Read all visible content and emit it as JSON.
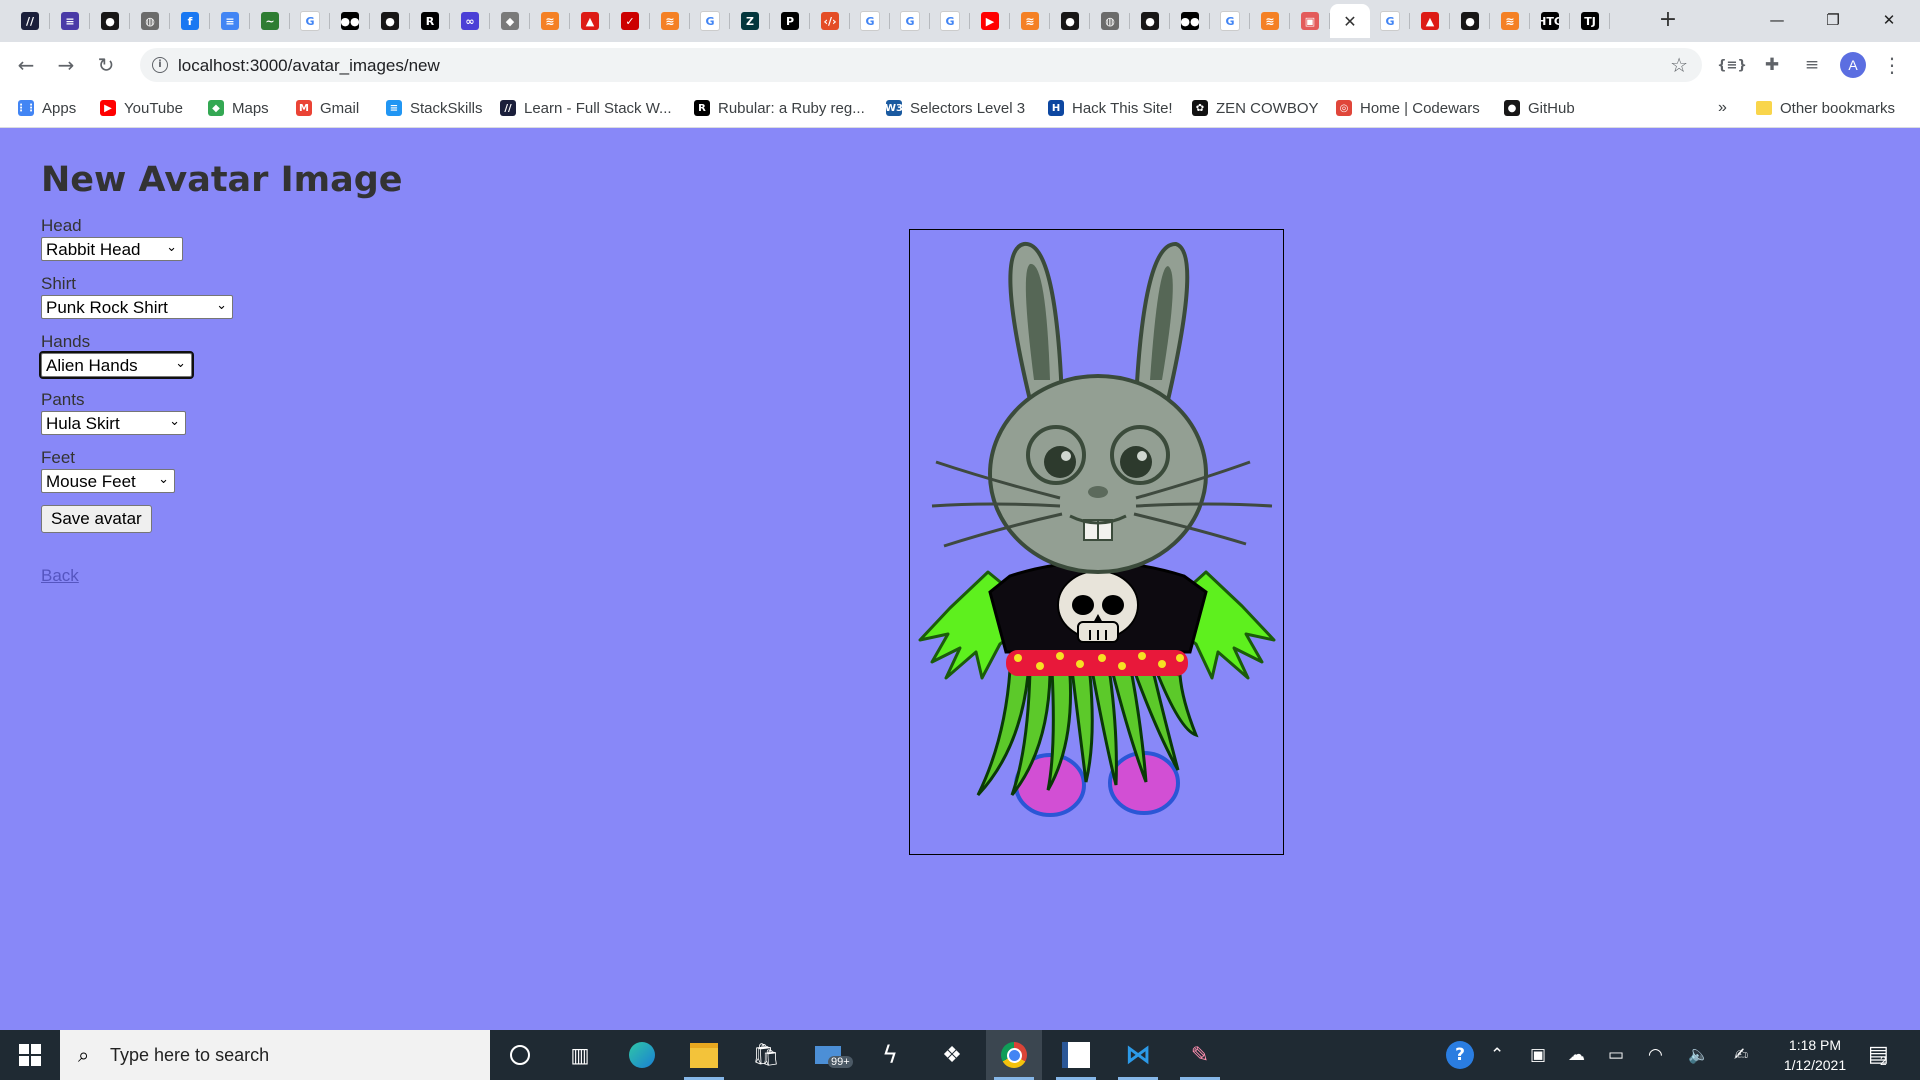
{
  "browser": {
    "tabs": [
      {
        "icon": "toptal-icon",
        "glyph": "//",
        "color": "#1b1f3b"
      },
      {
        "icon": "list-app-icon",
        "glyph": "≡",
        "color": "#4a3aa7"
      },
      {
        "icon": "github-icon",
        "glyph": "●",
        "color": "#181717"
      },
      {
        "icon": "globe-icon",
        "glyph": "◍",
        "color": "#6b6b6b"
      },
      {
        "icon": "facebook-icon",
        "glyph": "f",
        "color": "#1877f2"
      },
      {
        "icon": "google-docs-icon",
        "glyph": "≡",
        "color": "#4285f4"
      },
      {
        "icon": "regex-icon",
        "glyph": "~",
        "color": "#2e7d32"
      },
      {
        "icon": "google-icon",
        "glyph": "G",
        "color": "#ffffff"
      },
      {
        "icon": "medium-icon",
        "glyph": "●●",
        "color": "#000000"
      },
      {
        "icon": "github-icon",
        "glyph": "●",
        "color": "#181717"
      },
      {
        "icon": "rubular-icon",
        "glyph": "R",
        "color": "#000000"
      },
      {
        "icon": "purple-app-icon",
        "glyph": "∞",
        "color": "#4b3fd6"
      },
      {
        "icon": "shield-icon",
        "glyph": "◆",
        "color": "#7a7a7a"
      },
      {
        "icon": "stack-icon",
        "glyph": "≋",
        "color": "#f48024"
      },
      {
        "icon": "angular-icon",
        "glyph": "▲",
        "color": "#dd1b16"
      },
      {
        "icon": "rails-icon",
        "glyph": "✓",
        "color": "#cc0000"
      },
      {
        "icon": "stack-icon",
        "glyph": "≋",
        "color": "#f48024"
      },
      {
        "icon": "google-icon",
        "glyph": "G",
        "color": "#ffffff"
      },
      {
        "icon": "zendesk-icon",
        "glyph": "Z",
        "color": "#03363d"
      },
      {
        "icon": "producthunt-icon",
        "glyph": "P",
        "color": "#000000"
      },
      {
        "icon": "code-icon",
        "glyph": "‹/›",
        "color": "#e44d26"
      },
      {
        "icon": "google-icon",
        "glyph": "G",
        "color": "#ffffff"
      },
      {
        "icon": "google-icon",
        "glyph": "G",
        "color": "#ffffff"
      },
      {
        "icon": "google-icon",
        "glyph": "G",
        "color": "#ffffff"
      },
      {
        "icon": "youtube-icon",
        "glyph": "▶",
        "color": "#ff0000"
      },
      {
        "icon": "stack-icon",
        "glyph": "≋",
        "color": "#f48024"
      },
      {
        "icon": "github-icon",
        "glyph": "●",
        "color": "#181717"
      },
      {
        "icon": "globe-icon",
        "glyph": "◍",
        "color": "#6b6b6b"
      },
      {
        "icon": "github-icon",
        "glyph": "●",
        "color": "#181717"
      },
      {
        "icon": "medium-icon",
        "glyph": "●●",
        "color": "#000000"
      },
      {
        "icon": "google-icon",
        "glyph": "G",
        "color": "#ffffff"
      },
      {
        "icon": "stack-icon",
        "glyph": "≋",
        "color": "#f48024"
      },
      {
        "icon": "app-icon",
        "glyph": "▣",
        "color": "#e35b5b"
      },
      {
        "icon": "close-icon",
        "glyph": "✕",
        "color": "#ffffff",
        "active": true
      },
      {
        "icon": "google-icon",
        "glyph": "G",
        "color": "#ffffff"
      },
      {
        "icon": "angular-icon",
        "glyph": "▲",
        "color": "#dd1b16"
      },
      {
        "icon": "github-icon",
        "glyph": "●",
        "color": "#181717"
      },
      {
        "icon": "stack-icon",
        "glyph": "≋",
        "color": "#f48024"
      },
      {
        "icon": "htg-icon",
        "glyph": "HTG",
        "color": "#000000"
      },
      {
        "icon": "intellij-icon",
        "glyph": "TJ",
        "color": "#000000"
      }
    ],
    "url": "localhost:3000/avatar_images/new",
    "avatar_letter": "A",
    "bookmarks": [
      {
        "label": "Apps",
        "icon": "apps-grid-icon",
        "glyph": "⋮⋮",
        "color": "#4285f4"
      },
      {
        "label": "YouTube",
        "icon": "youtube-icon",
        "glyph": "▶",
        "color": "#ff0000"
      },
      {
        "label": "Maps",
        "icon": "maps-icon",
        "glyph": "◆",
        "color": "#34a853"
      },
      {
        "label": "Gmail",
        "icon": "gmail-icon",
        "glyph": "M",
        "color": "#ea4335"
      },
      {
        "label": "StackSkills",
        "icon": "stackskills-icon",
        "glyph": "≡",
        "color": "#2196f3"
      },
      {
        "label": "Learn - Full Stack W...",
        "icon": "toptal-icon",
        "glyph": "//",
        "color": "#1b1f3b"
      },
      {
        "label": "Rubular: a Ruby reg...",
        "icon": "rubular-icon",
        "glyph": "R",
        "color": "#000000"
      },
      {
        "label": "Selectors Level 3",
        "icon": "w3c-icon",
        "glyph": "W3",
        "color": "#1a5aa0"
      },
      {
        "label": "Hack This Site!",
        "icon": "hackthissite-icon",
        "glyph": "H",
        "color": "#0d47a1"
      },
      {
        "label": "ZEN COWBOY",
        "icon": "zencowboy-icon",
        "glyph": "✿",
        "color": "#111111"
      },
      {
        "label": "Home | Codewars",
        "icon": "codewars-icon",
        "glyph": "◎",
        "color": "#e0463a"
      },
      {
        "label": "GitHub",
        "icon": "github-icon",
        "glyph": "●",
        "color": "#181717"
      }
    ],
    "more_bookmarks": "»",
    "other_bookmarks": "Other bookmarks"
  },
  "page": {
    "title": "New Avatar Image",
    "fields": [
      {
        "label": "Head",
        "value": "Rabbit Head"
      },
      {
        "label": "Shirt",
        "value": "Punk Rock Shirt"
      },
      {
        "label": "Hands",
        "value": "Alien Hands"
      },
      {
        "label": "Pants",
        "value": "Hula Skirt"
      },
      {
        "label": "Feet",
        "value": "Mouse Feet"
      }
    ],
    "save_label": "Save avatar",
    "back_label": "Back"
  },
  "taskbar": {
    "search_placeholder": "Type here to search",
    "mail_badge": "99+",
    "time": "1:18 PM",
    "date": "1/12/2021",
    "notification_count": "2"
  },
  "colors": {
    "page_bg": "#8888f8",
    "taskbar_bg": "#1f2a33"
  }
}
